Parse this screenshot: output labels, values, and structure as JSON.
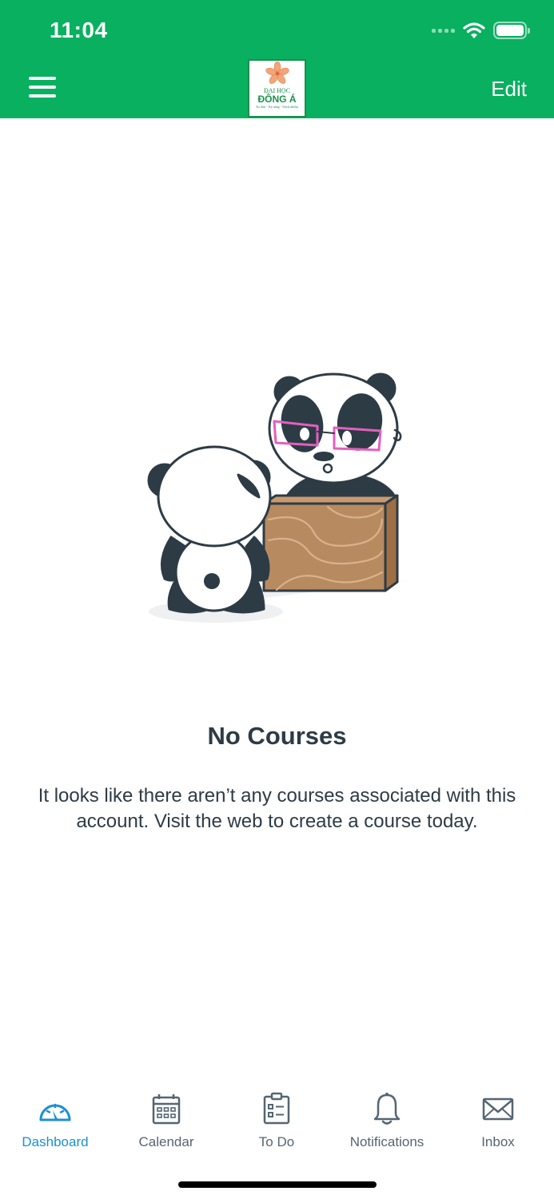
{
  "status_bar": {
    "time": "11:04"
  },
  "header": {
    "logo": {
      "line1": "ĐẠI HỌC",
      "line2": "ĐÔNG Á",
      "line3": "Tri thức - Kỹ năng - Trách nhiệm"
    },
    "edit_label": "Edit"
  },
  "empty_state": {
    "title": "No Courses",
    "message": "It looks like there aren’t any courses associated with this account. Visit the web to create a course today."
  },
  "tabs": [
    {
      "label": "Dashboard",
      "icon": "dashboard-icon",
      "active": true
    },
    {
      "label": "Calendar",
      "icon": "calendar-icon",
      "active": false
    },
    {
      "label": "To Do",
      "icon": "todo-icon",
      "active": false
    },
    {
      "label": "Notifications",
      "icon": "bell-icon",
      "active": false
    },
    {
      "label": "Inbox",
      "icon": "envelope-icon",
      "active": false
    }
  ],
  "colors": {
    "brand_green": "#08b060",
    "active_tab": "#1c8ed6",
    "inactive_tab": "#556572",
    "text_dark": "#2d3b45"
  }
}
